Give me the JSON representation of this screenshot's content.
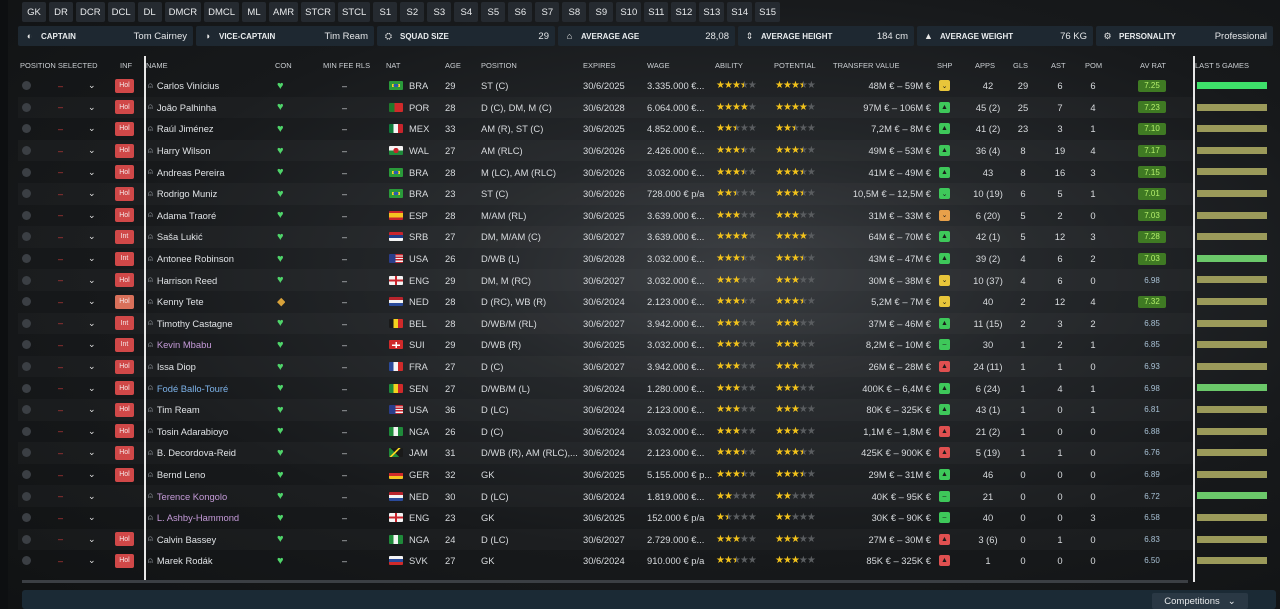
{
  "position_filters": [
    "GK",
    "DR",
    "DCR",
    "DCL",
    "DL",
    "DMCR",
    "DMCL",
    "ML",
    "AMR",
    "STCR",
    "STCL",
    "S1",
    "S2",
    "S3",
    "S4",
    "S5",
    "S6",
    "S7",
    "S8",
    "S9",
    "S10",
    "S11",
    "S12",
    "S13",
    "S14",
    "S15"
  ],
  "squad_info": {
    "captain_label": "CAPTAIN",
    "captain": "Tom Cairney",
    "vice_label": "VICE-CAPTAIN",
    "vice": "Tim Ream",
    "size_label": "SQUAD SIZE",
    "size": "29",
    "age_label": "AVERAGE AGE",
    "age": "28,08",
    "height_label": "AVERAGE HEIGHT",
    "height": "184 cm",
    "weight_label": "AVERAGE WEIGHT",
    "weight": "76 KG",
    "personality_label": "PERSONALITY",
    "personality": "Professional"
  },
  "headers": {
    "position_selected": "POSITION SELECTED",
    "inf": "INF",
    "name": "NAME",
    "con": "CON",
    "min_fee": "MIN FEE RLS",
    "nat": "NAT",
    "age": "AGE",
    "position": "POSITION",
    "expires": "EXPIRES",
    "wage": "WAGE",
    "ability": "ABILITY",
    "potential": "POTENTIAL",
    "transfer_value": "TRANSFER VALUE",
    "shp": "SHP",
    "apps": "APPS",
    "gls": "GLS",
    "ast": "AST",
    "pom": "POM",
    "av_rat": "AV RAT",
    "last5": "LAST 5 GAMES"
  },
  "colors": {
    "rating_green": "#3f7a23",
    "stars": "#f2c21b",
    "inf_red": "#d04848",
    "con_green": "#4fd46a",
    "last5_green": "#3ee06a",
    "last5_olive": "#9b9a5a"
  },
  "players": [
    {
      "sel": "–",
      "inf": "Hol",
      "name": "Carlos Vinícius",
      "name_color": "normal",
      "con": "heart",
      "min_fee": "–",
      "flag": "bra",
      "nat": "BRA",
      "age": "29",
      "position": "ST (C)",
      "expires": "30/6/2025",
      "wage": "3.335.000 €...",
      "ability": 3.5,
      "potential": 3.5,
      "value": "48M € – 59M €",
      "shp": "down",
      "shp_color": "yellow",
      "apps": "42",
      "gls": "29",
      "ast": "6",
      "pom": "6",
      "rating": "7.25",
      "rating_style": "green",
      "last5": "bright"
    },
    {
      "sel": "–",
      "inf": "Hol",
      "name": "João Palhinha",
      "name_color": "normal",
      "con": "heart",
      "min_fee": "–",
      "flag": "por",
      "nat": "POR",
      "age": "28",
      "position": "D (C), DM, M (C)",
      "expires": "30/6/2028",
      "wage": "6.064.000 €...",
      "ability": 4,
      "potential": 4,
      "value": "97M € – 106M €",
      "shp": "up",
      "shp_color": "green",
      "apps": "45 (2)",
      "gls": "25",
      "ast": "7",
      "pom": "4",
      "rating": "7.23",
      "rating_style": "green",
      "last5": "olive"
    },
    {
      "sel": "–",
      "inf": "Hol",
      "name": "Raúl Jiménez",
      "name_color": "normal",
      "con": "heart",
      "min_fee": "–",
      "flag": "mex",
      "nat": "MEX",
      "age": "33",
      "position": "AM (R), ST (C)",
      "expires": "30/6/2025",
      "wage": "4.852.000 €...",
      "ability": 2.5,
      "potential": 2.5,
      "value": "7,2M € – 8M €",
      "shp": "up",
      "shp_color": "green",
      "apps": "41 (2)",
      "gls": "23",
      "ast": "3",
      "pom": "1",
      "rating": "7.10",
      "rating_style": "green",
      "last5": "olive"
    },
    {
      "sel": "–",
      "inf": "Hol",
      "name": "Harry Wilson",
      "name_color": "normal",
      "con": "heart",
      "min_fee": "–",
      "flag": "wal",
      "nat": "WAL",
      "age": "27",
      "position": "AM (RLC)",
      "expires": "30/6/2026",
      "wage": "2.426.000 €...",
      "ability": 3.5,
      "potential": 3.5,
      "value": "49M € – 53M €",
      "shp": "up",
      "shp_color": "green",
      "apps": "36 (4)",
      "gls": "8",
      "ast": "19",
      "pom": "4",
      "rating": "7.17",
      "rating_style": "green",
      "last5": "olive"
    },
    {
      "sel": "–",
      "inf": "Hol",
      "name": "Andreas Pereira",
      "name_color": "normal",
      "con": "heart",
      "min_fee": "–",
      "flag": "bra",
      "nat": "BRA",
      "age": "28",
      "position": "M (LC), AM (RLC)",
      "expires": "30/6/2026",
      "wage": "3.032.000 €...",
      "ability": 3.5,
      "potential": 3.5,
      "value": "41M € – 49M €",
      "shp": "up",
      "shp_color": "green",
      "apps": "43",
      "gls": "8",
      "ast": "16",
      "pom": "3",
      "rating": "7.15",
      "rating_style": "green",
      "last5": "olive"
    },
    {
      "sel": "–",
      "inf": "Hol",
      "name": "Rodrigo Muniz",
      "name_color": "normal",
      "con": "heart",
      "min_fee": "–",
      "flag": "bra",
      "nat": "BRA",
      "age": "23",
      "position": "ST (C)",
      "expires": "30/6/2026",
      "wage": "728.000 € p/a",
      "ability": 2.5,
      "potential": 3.5,
      "value": "10,5M € – 12,5M €",
      "shp": "down",
      "shp_color": "green",
      "apps": "10 (19)",
      "gls": "6",
      "ast": "5",
      "pom": "1",
      "rating": "7.01",
      "rating_style": "green",
      "last5": "olive"
    },
    {
      "sel": "–",
      "inf": "Hol",
      "name": "Adama Traoré",
      "name_color": "normal",
      "con": "heart",
      "min_fee": "–",
      "flag": "esp",
      "nat": "ESP",
      "age": "28",
      "position": "M/AM (RL)",
      "expires": "30/6/2025",
      "wage": "3.639.000 €...",
      "ability": 3,
      "potential": 3,
      "value": "31M € – 33M €",
      "shp": "down",
      "shp_color": "orange",
      "apps": "6 (20)",
      "gls": "5",
      "ast": "2",
      "pom": "0",
      "rating": "7.03",
      "rating_style": "green",
      "last5": "olive"
    },
    {
      "sel": "–",
      "inf": "Int",
      "name": "Saša Lukić",
      "name_color": "normal",
      "con": "heart",
      "min_fee": "–",
      "flag": "srb",
      "nat": "SRB",
      "age": "27",
      "position": "DM, M/AM (C)",
      "expires": "30/6/2027",
      "wage": "3.639.000 €...",
      "ability": 4,
      "potential": 4,
      "value": "64M € – 70M €",
      "shp": "up",
      "shp_color": "green",
      "apps": "42 (1)",
      "gls": "5",
      "ast": "12",
      "pom": "3",
      "rating": "7.28",
      "rating_style": "green",
      "last5": "olive"
    },
    {
      "sel": "–",
      "inf": "Int",
      "name": "Antonee Robinson",
      "name_color": "normal",
      "con": "heart",
      "min_fee": "–",
      "flag": "usa",
      "nat": "USA",
      "age": "26",
      "position": "D/WB (L)",
      "expires": "30/6/2028",
      "wage": "3.032.000 €...",
      "ability": 3.5,
      "potential": 3.5,
      "value": "43M € – 47M €",
      "shp": "up",
      "shp_color": "green",
      "apps": "39 (2)",
      "gls": "4",
      "ast": "6",
      "pom": "2",
      "rating": "7.03",
      "rating_style": "green",
      "last5": "green"
    },
    {
      "sel": "–",
      "inf": "Hol",
      "name": "Harrison Reed",
      "name_color": "normal",
      "con": "heart",
      "min_fee": "–",
      "flag": "eng",
      "nat": "ENG",
      "age": "29",
      "position": "DM, M (RC)",
      "expires": "30/6/2027",
      "wage": "3.032.000 €...",
      "ability": 3,
      "potential": 3,
      "value": "30M € – 38M €",
      "shp": "down",
      "shp_color": "yellow",
      "apps": "10 (37)",
      "gls": "4",
      "ast": "6",
      "pom": "0",
      "rating": "6.98",
      "rating_style": "blue",
      "last5": "olive"
    },
    {
      "sel": "–",
      "inf": "Hol",
      "name": "Kenny Tete",
      "name_color": "normal",
      "con": "shield",
      "min_fee": "–",
      "flag": "ned",
      "nat": "NED",
      "age": "28",
      "position": "D (RC), WB (R)",
      "expires": "30/6/2024",
      "wage": "2.123.000 €...",
      "ability": 3.5,
      "potential": 3.5,
      "value": "5,2M € – 7M €",
      "shp": "down",
      "shp_color": "yellow",
      "apps": "40",
      "gls": "2",
      "ast": "12",
      "pom": "4",
      "rating": "7.32",
      "rating_style": "green",
      "last5": "olive"
    },
    {
      "sel": "–",
      "inf": "Int",
      "name": "Timothy Castagne",
      "name_color": "normal",
      "con": "heart",
      "min_fee": "–",
      "flag": "bel",
      "nat": "BEL",
      "age": "28",
      "position": "D/WB/M (RL)",
      "expires": "30/6/2027",
      "wage": "3.942.000 €...",
      "ability": 3,
      "potential": 3,
      "value": "37M € – 46M €",
      "shp": "up",
      "shp_color": "green",
      "apps": "11 (15)",
      "gls": "2",
      "ast": "3",
      "pom": "2",
      "rating": "6.85",
      "rating_style": "blue",
      "last5": "olive"
    },
    {
      "sel": "–",
      "inf": "Int",
      "name": "Kevin Mbabu",
      "name_color": "purple",
      "con": "heart",
      "min_fee": "–",
      "flag": "sui",
      "nat": "SUI",
      "age": "29",
      "position": "D/WB (R)",
      "expires": "30/6/2025",
      "wage": "3.032.000 €...",
      "ability": 3,
      "potential": 3,
      "value": "8,2M € – 10M €",
      "shp": "flat",
      "shp_color": "green",
      "apps": "30",
      "gls": "1",
      "ast": "2",
      "pom": "1",
      "rating": "6.85",
      "rating_style": "blue",
      "last5": "olive"
    },
    {
      "sel": "–",
      "inf": "Hol",
      "name": "Issa Diop",
      "name_color": "normal",
      "con": "heart",
      "min_fee": "–",
      "flag": "fra",
      "nat": "FRA",
      "age": "27",
      "position": "D (C)",
      "expires": "30/6/2027",
      "wage": "3.942.000 €...",
      "ability": 3,
      "potential": 3,
      "value": "26M € – 28M €",
      "shp": "up",
      "shp_color": "red",
      "apps": "24 (11)",
      "gls": "1",
      "ast": "1",
      "pom": "0",
      "rating": "6.93",
      "rating_style": "blue",
      "last5": "olive"
    },
    {
      "sel": "–",
      "inf": "Hol",
      "name": "Fodé Ballo-Touré",
      "name_color": "blue",
      "con": "heart",
      "min_fee": "–",
      "flag": "sen",
      "nat": "SEN",
      "age": "27",
      "position": "D/WB/M (L)",
      "expires": "30/6/2024",
      "wage": "1.280.000 €...",
      "ability": 3,
      "potential": 3,
      "value": "400K € – 6,4M €",
      "shp": "up",
      "shp_color": "green",
      "apps": "6 (24)",
      "gls": "1",
      "ast": "4",
      "pom": "1",
      "rating": "6.98",
      "rating_style": "blue",
      "last5": "green"
    },
    {
      "sel": "–",
      "inf": "Hol",
      "name": "Tim Ream",
      "name_color": "normal",
      "con": "heart",
      "min_fee": "–",
      "flag": "usa",
      "nat": "USA",
      "age": "36",
      "position": "D (LC)",
      "expires": "30/6/2024",
      "wage": "2.123.000 €...",
      "ability": 3,
      "potential": 3,
      "value": "80K € – 325K €",
      "shp": "up",
      "shp_color": "green",
      "apps": "43 (1)",
      "gls": "1",
      "ast": "0",
      "pom": "1",
      "rating": "6.81",
      "rating_style": "blue",
      "last5": "olive"
    },
    {
      "sel": "–",
      "inf": "Hol",
      "name": "Tosin Adarabioyo",
      "name_color": "normal",
      "con": "heart",
      "min_fee": "–",
      "flag": "nga",
      "nat": "NGA",
      "age": "26",
      "position": "D (C)",
      "expires": "30/6/2024",
      "wage": "3.032.000 €...",
      "ability": 3,
      "potential": 3,
      "value": "1,1M € – 1,8M €",
      "shp": "up",
      "shp_color": "red",
      "apps": "21 (2)",
      "gls": "1",
      "ast": "0",
      "pom": "0",
      "rating": "6.88",
      "rating_style": "blue",
      "last5": "olive"
    },
    {
      "sel": "–",
      "inf": "Hol",
      "name": "B. Decordova-Reid",
      "name_color": "normal",
      "con": "heart",
      "min_fee": "–",
      "flag": "jam",
      "nat": "JAM",
      "age": "31",
      "position": "D/WB (R), AM (RLC),...",
      "expires": "30/6/2024",
      "wage": "2.123.000 €...",
      "ability": 3.5,
      "potential": 3.5,
      "value": "425K € – 900K €",
      "shp": "up",
      "shp_color": "red",
      "apps": "5 (19)",
      "gls": "1",
      "ast": "1",
      "pom": "0",
      "rating": "6.76",
      "rating_style": "blue",
      "last5": "olive"
    },
    {
      "sel": "–",
      "inf": "Hol",
      "name": "Bernd Leno",
      "name_color": "normal",
      "con": "heart",
      "min_fee": "–",
      "flag": "ger",
      "nat": "GER",
      "age": "32",
      "position": "GK",
      "expires": "30/6/2025",
      "wage": "5.155.000 € p...",
      "ability": 3.5,
      "potential": 3.5,
      "value": "29M € – 31M €",
      "shp": "up",
      "shp_color": "green",
      "apps": "46",
      "gls": "0",
      "ast": "0",
      "pom": "0",
      "rating": "6.89",
      "rating_style": "blue",
      "last5": "olive"
    },
    {
      "sel": "–",
      "inf": "",
      "name": "Terence Kongolo",
      "name_color": "purple",
      "con": "heart",
      "min_fee": "–",
      "flag": "ned",
      "nat": "NED",
      "age": "30",
      "position": "D (LC)",
      "expires": "30/6/2024",
      "wage": "1.819.000 €...",
      "ability": 2,
      "potential": 2,
      "value": "40K € – 95K €",
      "shp": "flat",
      "shp_color": "green",
      "apps": "21",
      "gls": "0",
      "ast": "0",
      "pom": "0",
      "rating": "6.72",
      "rating_style": "blue",
      "last5": "green"
    },
    {
      "sel": "–",
      "inf": "",
      "name": "L. Ashby-Hammond",
      "name_color": "purple",
      "con": "heart",
      "min_fee": "–",
      "flag": "eng",
      "nat": "ENG",
      "age": "23",
      "position": "GK",
      "expires": "30/6/2025",
      "wage": "152.000 € p/a",
      "ability": 1.5,
      "potential": 2,
      "value": "30K € – 90K €",
      "shp": "flat",
      "shp_color": "green",
      "apps": "40",
      "gls": "0",
      "ast": "0",
      "pom": "3",
      "rating": "6.58",
      "rating_style": "blue",
      "last5": "olive"
    },
    {
      "sel": "–",
      "inf": "Hol",
      "name": "Calvin Bassey",
      "name_color": "normal",
      "con": "heart",
      "min_fee": "–",
      "flag": "nga",
      "nat": "NGA",
      "age": "24",
      "position": "D (LC)",
      "expires": "30/6/2027",
      "wage": "2.729.000 €...",
      "ability": 3,
      "potential": 3,
      "value": "27M € – 30M €",
      "shp": "up",
      "shp_color": "red",
      "apps": "3 (6)",
      "gls": "0",
      "ast": "1",
      "pom": "0",
      "rating": "6.83",
      "rating_style": "blue",
      "last5": "olive"
    },
    {
      "sel": "–",
      "inf": "Hol",
      "name": "Marek Rodák",
      "name_color": "normal",
      "con": "heart",
      "min_fee": "–",
      "flag": "svk",
      "nat": "SVK",
      "age": "27",
      "position": "GK",
      "expires": "30/6/2024",
      "wage": "910.000 € p/a",
      "ability": 2.5,
      "potential": 3,
      "value": "85K € – 325K €",
      "shp": "up",
      "shp_color": "red",
      "apps": "1",
      "gls": "0",
      "ast": "0",
      "pom": "0",
      "rating": "6.50",
      "rating_style": "blue",
      "last5": "olive"
    }
  ],
  "bottom": {
    "competitions": "Competitions"
  }
}
